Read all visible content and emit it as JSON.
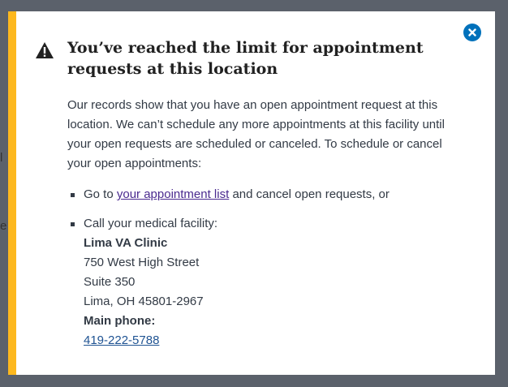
{
  "modal": {
    "title": "You’ve reached the limit for appointment requests at this location",
    "intro": "Our records show that you have an open appointment request at this location. We can’t schedule any more appointments at this facility until your open requests are scheduled or canceled. To schedule or cancel your open appointments:",
    "bullet1_prefix": "Go to",
    "bullet1_link": "your appointment list",
    "bullet1_suffix": "and cancel open requests, or",
    "bullet2_lead": "Call your medical facility:",
    "facility": {
      "name": "Lima VA Clinic",
      "street": "750 West High Street",
      "suite": "Suite 350",
      "city": "Lima, OH 45801-2967",
      "phone_label": "Main phone:",
      "phone": "419-222-5788"
    }
  },
  "icons": {
    "close": "close-icon",
    "warning": "warning-icon"
  },
  "colors": {
    "accent": "#fdb81e",
    "link": "#4a2a8f",
    "close": "#0071bb"
  },
  "background": {
    "fragment1": "l",
    "fragment2": "e"
  }
}
